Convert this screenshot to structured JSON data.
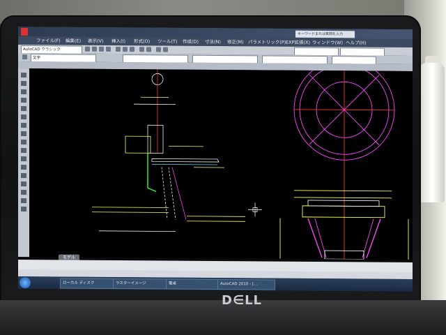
{
  "app": {
    "title": "AutoCAD 2010",
    "workspace": "AutoCAD クラシック"
  },
  "menu": {
    "items": [
      "ファイル(F)",
      "編集(E)",
      "表示(V)",
      "挿入(I)",
      "形式(O)",
      "ツール(T)",
      "作成(D)",
      "寸法(N)",
      "修正(M)",
      "パラメトリック(P)",
      "EXP拡張(X)",
      "ウィンドウ(W)",
      "ヘルプ(H)"
    ],
    "search_placeholder": "キーワードまたは質問を入力"
  },
  "toolbar": {
    "workspace_combo": "AutoCAD クラシック",
    "style_combo": "文字"
  },
  "tabs": {
    "model": "モデル"
  },
  "taskbar": {
    "items": [
      "ローカル ディスク",
      "ラスターイメージ",
      "電卓",
      "AutoCAD 2010 - [..."
    ]
  },
  "colors": {
    "canvas": "#000000",
    "menubar": "#3c4a61",
    "magenta": "#ff44ff",
    "yellow": "#ffff55",
    "red": "#ff3333",
    "green": "#33dd33",
    "white": "#f2f2f2",
    "cyan": "#55e0ff"
  },
  "icons": [
    "autocad-app-icon",
    "start-orb-icon",
    "crosshair-cursor-icon",
    "dell-logo"
  ]
}
